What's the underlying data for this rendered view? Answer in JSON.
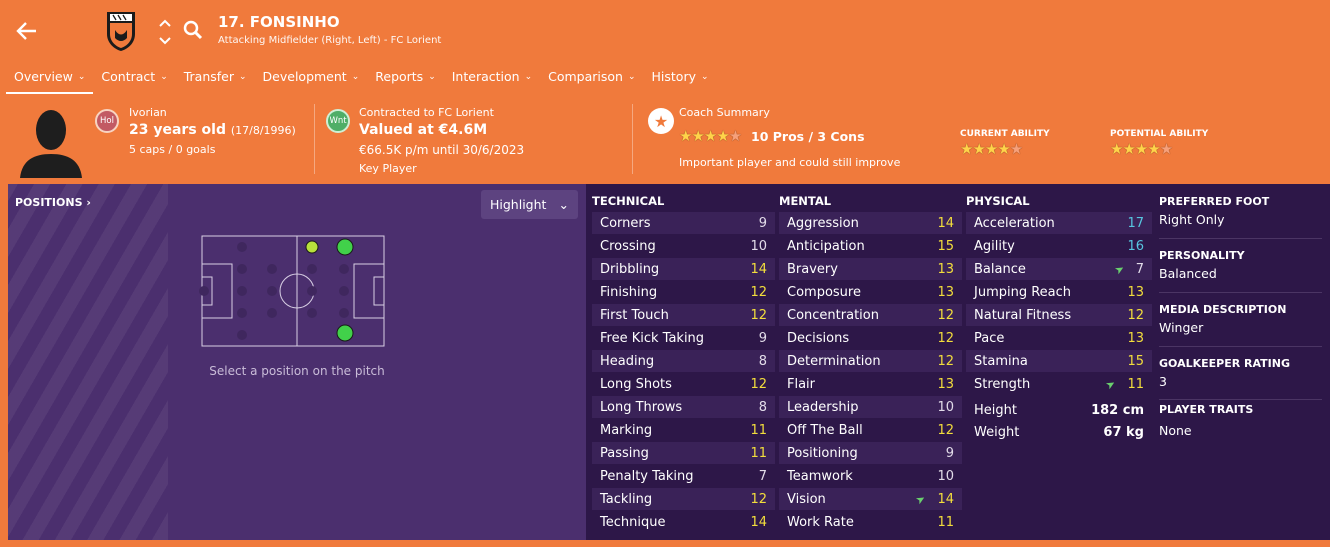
{
  "header": {
    "player_name": "17. FONSINHO",
    "subtitle": "Attacking Midfielder (Right, Left) - FC Lorient",
    "club_logo_text": "FC LORIENT"
  },
  "tabs": [
    "Overview",
    "Contract",
    "Transfer",
    "Development",
    "Reports",
    "Interaction",
    "Comparison",
    "History"
  ],
  "profile": {
    "nationality_badge": "Hol",
    "nationality": "Ivorian",
    "age": "23 years old",
    "dob": "(17/8/1996)",
    "caps": "5 caps / 0 goals",
    "contract_badge": "Wnt",
    "contracted_to": "Contracted to FC Lorient",
    "value": "Valued at €4.6M",
    "wage": "€66.5K p/m until 30/6/2023",
    "squad_status": "Key Player"
  },
  "coach": {
    "title": "Coach Summary",
    "stars": 3.5,
    "pros_cons": "10 Pros / 3 Cons",
    "summary": "Important player and could still improve",
    "current_ability_label": "CURRENT ABILITY",
    "current_ability_stars": 3.5,
    "potential_ability_label": "POTENTIAL ABILITY",
    "potential_ability_stars": 3.5
  },
  "positions": {
    "title": "POSITIONS ›",
    "highlight_label": "Highlight",
    "hint": "Select a position on the pitch"
  },
  "technical": {
    "title": "TECHNICAL",
    "attributes": [
      {
        "name": "Corners",
        "value": "9"
      },
      {
        "name": "Crossing",
        "value": "10"
      },
      {
        "name": "Dribbling",
        "value": "14"
      },
      {
        "name": "Finishing",
        "value": "12"
      },
      {
        "name": "First Touch",
        "value": "12"
      },
      {
        "name": "Free Kick Taking",
        "value": "9"
      },
      {
        "name": "Heading",
        "value": "8"
      },
      {
        "name": "Long Shots",
        "value": "12"
      },
      {
        "name": "Long Throws",
        "value": "8"
      },
      {
        "name": "Marking",
        "value": "11"
      },
      {
        "name": "Passing",
        "value": "11"
      },
      {
        "name": "Penalty Taking",
        "value": "7"
      },
      {
        "name": "Tackling",
        "value": "12"
      },
      {
        "name": "Technique",
        "value": "14"
      }
    ]
  },
  "mental": {
    "title": "MENTAL",
    "attributes": [
      {
        "name": "Aggression",
        "value": "14"
      },
      {
        "name": "Anticipation",
        "value": "15"
      },
      {
        "name": "Bravery",
        "value": "13"
      },
      {
        "name": "Composure",
        "value": "13"
      },
      {
        "name": "Concentration",
        "value": "12"
      },
      {
        "name": "Decisions",
        "value": "12"
      },
      {
        "name": "Determination",
        "value": "12"
      },
      {
        "name": "Flair",
        "value": "13"
      },
      {
        "name": "Leadership",
        "value": "10"
      },
      {
        "name": "Off The Ball",
        "value": "12"
      },
      {
        "name": "Positioning",
        "value": "9"
      },
      {
        "name": "Teamwork",
        "value": "10"
      },
      {
        "name": "Vision",
        "value": "14",
        "trend": "up"
      },
      {
        "name": "Work Rate",
        "value": "11"
      }
    ]
  },
  "physical": {
    "title": "PHYSICAL",
    "attributes": [
      {
        "name": "Acceleration",
        "value": "17"
      },
      {
        "name": "Agility",
        "value": "16"
      },
      {
        "name": "Balance",
        "value": "7",
        "trend": "up"
      },
      {
        "name": "Jumping Reach",
        "value": "13"
      },
      {
        "name": "Natural Fitness",
        "value": "12"
      },
      {
        "name": "Pace",
        "value": "13"
      },
      {
        "name": "Stamina",
        "value": "15"
      },
      {
        "name": "Strength",
        "value": "11",
        "trend": "up"
      }
    ],
    "height_label": "Height",
    "height": "182 cm",
    "weight_label": "Weight",
    "weight": "67 kg"
  },
  "info": {
    "preferred_foot_label": "PREFERRED FOOT",
    "preferred_foot": "Right Only",
    "personality_label": "PERSONALITY",
    "personality": "Balanced",
    "media_label": "MEDIA DESCRIPTION",
    "media": "Winger",
    "gk_label": "GOALKEEPER RATING",
    "gk": "3",
    "traits_label": "PLAYER TRAITS",
    "traits": "None"
  },
  "colors": {
    "background": "#f07a3c",
    "panel": "#2d1748",
    "value_white": "#e2dce9",
    "value_yellow": "#f3de3c",
    "value_cyan": "#57c6e0",
    "trend_green": "#6ad06e"
  }
}
